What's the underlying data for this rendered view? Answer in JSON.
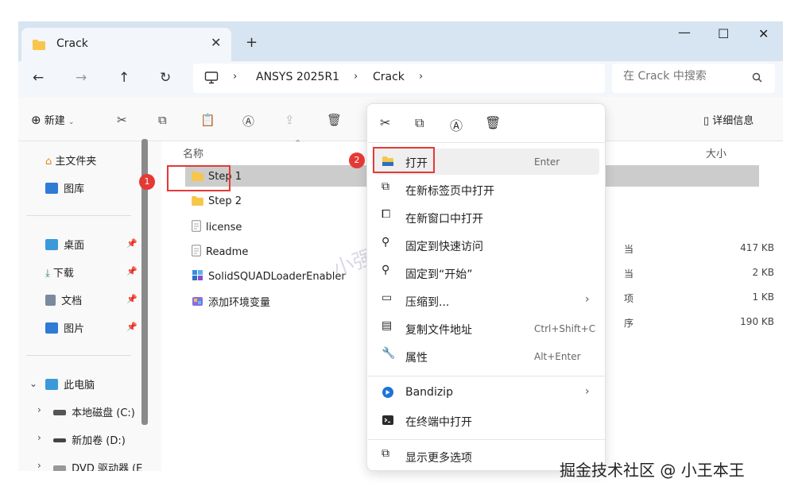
{
  "tab": {
    "title": "Crack",
    "close": "✕",
    "new_tab": "+"
  },
  "window_controls": {
    "minimize": "—",
    "maximize": "☐",
    "close": "✕"
  },
  "nav": {
    "back": "←",
    "forward": "→",
    "up": "↑",
    "refresh": "↻"
  },
  "breadcrumb": [
    {
      "label": "ANSYS 2025R1"
    },
    {
      "label": "Crack"
    }
  ],
  "breadcrumb_sep": "›",
  "search": {
    "placeholder": "在 Crack 中搜索"
  },
  "toolbar": {
    "new_label": "新建",
    "details_label": "详细信息"
  },
  "sidebar": {
    "quick": [
      {
        "label": "主文件夹"
      },
      {
        "label": "图库"
      }
    ],
    "pinned": [
      {
        "label": "桌面"
      },
      {
        "label": "下载"
      },
      {
        "label": "文档"
      },
      {
        "label": "图片"
      }
    ],
    "this_pc": "此电脑",
    "drives": [
      {
        "label": "本地磁盘 (C:)"
      },
      {
        "label": "新加卷 (D:)"
      },
      {
        "label": "DVD 驱动器 (E"
      }
    ],
    "pin_glyph": "📌"
  },
  "columns": {
    "name": "名称",
    "size": "大小"
  },
  "files": [
    {
      "name": "Step 1",
      "type": "",
      "size": ""
    },
    {
      "name": "Step 2",
      "type": "",
      "size": ""
    },
    {
      "name": "license",
      "type": "当",
      "size": "417 KB"
    },
    {
      "name": "Readme",
      "type": "当",
      "size": "2 KB"
    },
    {
      "name": "SolidSQUADLoaderEnabler",
      "type": "项",
      "size": "1 KB"
    },
    {
      "name": "添加环境变量",
      "type": "序",
      "size": "190 KB"
    }
  ],
  "badges": {
    "one": "1",
    "two": "2"
  },
  "context_menu": {
    "items": [
      {
        "label": "打开",
        "shortcut": "Enter"
      },
      {
        "label": "在新标签页中打开",
        "shortcut": ""
      },
      {
        "label": "在新窗口中打开",
        "shortcut": ""
      },
      {
        "label": "固定到快速访问",
        "shortcut": ""
      },
      {
        "label": "固定到“开始”",
        "shortcut": ""
      },
      {
        "label": "压缩到...",
        "shortcut": ""
      },
      {
        "label": "复制文件地址",
        "shortcut": "Ctrl+Shift+C"
      },
      {
        "label": "属性",
        "shortcut": "Alt+Enter"
      },
      {
        "label": "Bandizip",
        "shortcut": ""
      },
      {
        "label": "在终端中打开",
        "shortcut": ""
      },
      {
        "label": "显示更多选项",
        "shortcut": ""
      }
    ],
    "submenu_arrow": "›"
  },
  "watermark": "小强by.hom",
  "credit": "掘金技术社区 @ 小王本王",
  "colors": {
    "accent_red": "#e53935",
    "folder": "#f7c64a",
    "selected_row": "#cccccc",
    "titlebar": "#d7e4f1"
  }
}
